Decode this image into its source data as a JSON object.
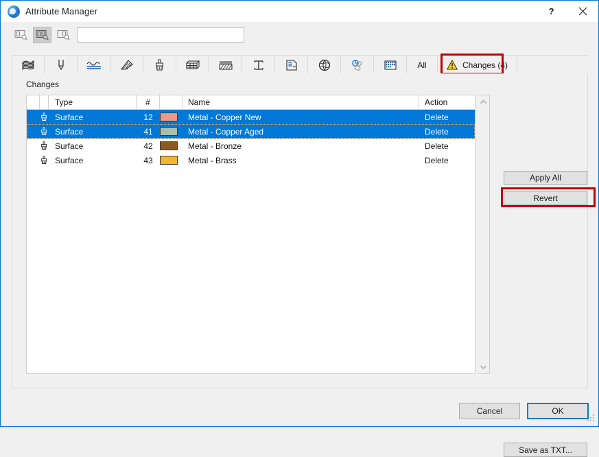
{
  "window": {
    "title": "Attribute Manager",
    "app_icon": "archicad-globe-icon",
    "help_label": "?",
    "close_label": "×"
  },
  "searchbar": {
    "mode_buttons": [
      {
        "name": "view-single-pane",
        "icon": "single-pane-search-icon",
        "active": false
      },
      {
        "name": "view-dual-pane",
        "icon": "dual-pane-search-icon",
        "active": true
      },
      {
        "name": "view-right-pane",
        "icon": "right-pane-search-icon",
        "active": false
      }
    ],
    "search_value": "",
    "search_placeholder": ""
  },
  "tabs": {
    "categories": [
      {
        "name": "tab-building-materials",
        "icon": "layers-icon"
      },
      {
        "name": "tab-pen-sets",
        "icon": "pen-icon"
      },
      {
        "name": "tab-line-types",
        "icon": "line-types-icon"
      },
      {
        "name": "tab-fill-types",
        "icon": "fill-types-icon"
      },
      {
        "name": "tab-surfaces",
        "icon": "paint-brush-icon"
      },
      {
        "name": "tab-composites",
        "icon": "composite-wall-icon"
      },
      {
        "name": "tab-profiles",
        "icon": "hatch-layers-icon"
      },
      {
        "name": "tab-beam-profiles",
        "icon": "i-beam-icon"
      },
      {
        "name": "tab-zone-categories",
        "icon": "zone-category-icon"
      },
      {
        "name": "tab-cities",
        "icon": "globe-icon"
      },
      {
        "name": "tab-mep-systems",
        "icon": "mep-systems-icon"
      },
      {
        "name": "tab-operation-profiles",
        "icon": "grid-icon"
      }
    ],
    "all_label": "All",
    "changes_label": "Changes (4)",
    "changes_icon": "warning-triangle-icon",
    "changes_highlighted": true
  },
  "main": {
    "section_label": "Changes",
    "columns": [
      {
        "key": "type",
        "label": "Type"
      },
      {
        "key": "num",
        "label": "#"
      },
      {
        "key": "name",
        "label": "Name"
      },
      {
        "key": "action",
        "label": "Action"
      }
    ],
    "rows": [
      {
        "icon": "paint-brush-icon",
        "type": "Surface",
        "num": "12",
        "swatch": "#e99b88",
        "name": "Metal - Copper New",
        "action": "Delete",
        "selected": true,
        "focused": false
      },
      {
        "icon": "paint-brush-icon",
        "type": "Surface",
        "num": "41",
        "swatch": "#a8bfab",
        "name": "Metal - Copper Aged",
        "action": "Delete",
        "selected": true,
        "focused": true
      },
      {
        "icon": "paint-brush-icon",
        "type": "Surface",
        "num": "42",
        "swatch": "#8b5a22",
        "name": "Metal - Bronze",
        "action": "Delete",
        "selected": false,
        "focused": false
      },
      {
        "icon": "paint-brush-icon",
        "type": "Surface",
        "num": "43",
        "swatch": "#f5b731",
        "name": "Metal - Brass",
        "action": "Delete",
        "selected": false,
        "focused": false
      }
    ],
    "buttons": {
      "apply_all": "Apply All",
      "revert": "Revert",
      "save_as_txt": "Save as TXT..."
    },
    "revert_highlighted": true,
    "scrollbar": {
      "up_icon": "chevron-up-icon",
      "down_icon": "chevron-down-icon"
    }
  },
  "footer": {
    "cancel": "Cancel",
    "ok": "OK",
    "ok_is_default": true
  },
  "colors": {
    "selection": "#0078d7",
    "highlight_box": "#c00000",
    "window_border": "#0078d7",
    "dialog_bg": "#f0f0f0"
  }
}
